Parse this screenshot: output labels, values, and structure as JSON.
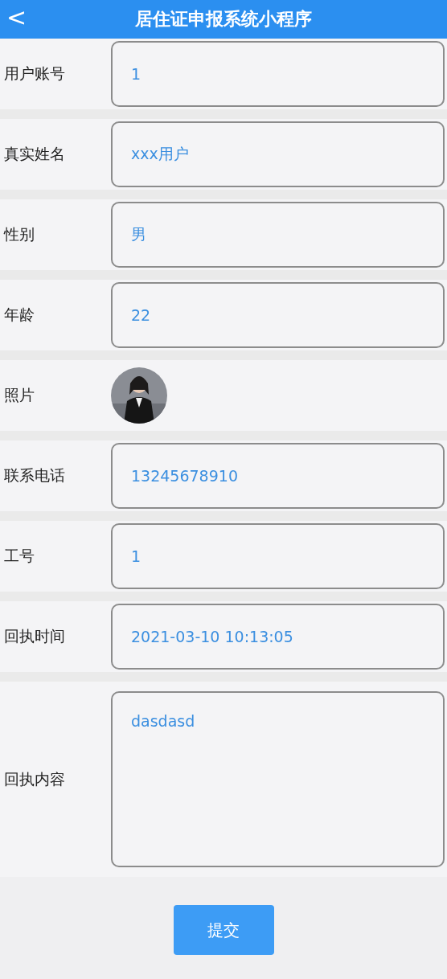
{
  "header": {
    "back": "<",
    "title": "居住证申报系统小程序"
  },
  "fields": [
    {
      "kind": "input",
      "label": "用户账号",
      "value": "1"
    },
    {
      "kind": "input",
      "label": "真实姓名",
      "value": "xxx用户"
    },
    {
      "kind": "input",
      "label": "性别",
      "value": "男"
    },
    {
      "kind": "input",
      "label": "年龄",
      "value": "22"
    },
    {
      "label": "照片"
    },
    {
      "kind": "input",
      "label": "联系电话",
      "value": "13245678910"
    },
    {
      "kind": "input",
      "label": "工号",
      "value": "1"
    },
    {
      "kind": "input",
      "label": "回执时间",
      "value": "2021-03-10 10:13:05"
    },
    {
      "kind": "textarea",
      "label": "回执内容",
      "value": "dasdasd"
    }
  ],
  "submit": "提交"
}
